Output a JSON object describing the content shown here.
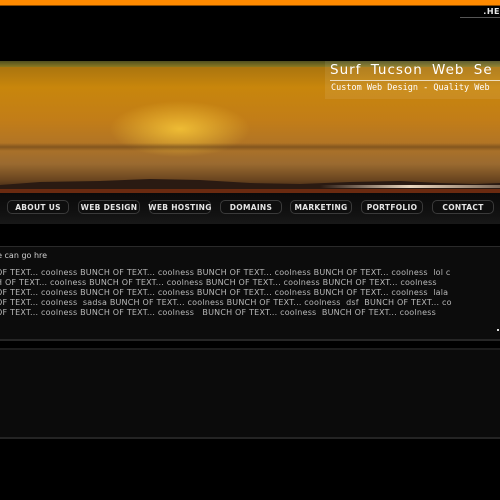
{
  "header": {
    "top_link": ".HE",
    "accent_color": "#ff8a00",
    "site_title": "Surf  Tucson  Web  Se",
    "tagline": "Custom Web Design - Quality Web"
  },
  "nav": {
    "items": [
      {
        "label": "ABOUT  US"
      },
      {
        "label": "WEB  DESIGN"
      },
      {
        "label": "WEB  HOSTING"
      },
      {
        "label": "DOMAINS"
      },
      {
        "label": "MARKETING"
      },
      {
        "label": "PORTFOLIO"
      },
      {
        "label": "CONTACT"
      }
    ]
  },
  "content": {
    "heading": "ne can go hre",
    "lines": [
      "OF TEXT... coolness BUNCH OF TEXT... coolness BUNCH OF TEXT... coolness BUNCH OF TEXT... coolness  lol c",
      "H OF TEXT... coolness BUNCH OF TEXT... coolness BUNCH OF TEXT... coolness BUNCH OF TEXT... coolness",
      "OF TEXT... coolness BUNCH OF TEXT... coolness BUNCH OF TEXT... coolness BUNCH OF TEXT... coolness  lala",
      "OF TEXT... coolness  sadsa BUNCH OF TEXT... coolness BUNCH OF TEXT... coolness  dsf  BUNCH OF TEXT... co",
      "OF TEXT... coolness BUNCH OF TEXT... coolness   BUNCH OF TEXT... coolness  BUNCH OF TEXT... coolness"
    ]
  }
}
